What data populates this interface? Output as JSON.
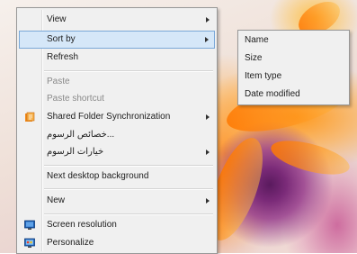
{
  "context_menu": {
    "items": [
      {
        "label": "View"
      },
      {
        "label": "Sort by"
      },
      {
        "label": "Refresh"
      },
      {
        "label": "Paste"
      },
      {
        "label": "Paste shortcut"
      },
      {
        "label": "Shared Folder Synchronization"
      },
      {
        "label": "...خصائص الرسوم"
      },
      {
        "label": "خيارات الرسوم"
      },
      {
        "label": "Next desktop background"
      },
      {
        "label": "New"
      },
      {
        "label": "Screen resolution"
      },
      {
        "label": "Personalize"
      }
    ]
  },
  "sort_submenu": {
    "items": [
      {
        "label": "Name"
      },
      {
        "label": "Size"
      },
      {
        "label": "Item type"
      },
      {
        "label": "Date modified"
      }
    ]
  },
  "icons": {
    "shared_folder": "sync-folder-icon",
    "screen_resolution": "monitor-icon",
    "personalize": "personalize-icon"
  },
  "colors": {
    "menu_bg": "#f0f0f0",
    "hover_bg": "#d5e7f8",
    "hover_border": "#7aa8d8",
    "disabled_text": "#8a8a8a"
  }
}
